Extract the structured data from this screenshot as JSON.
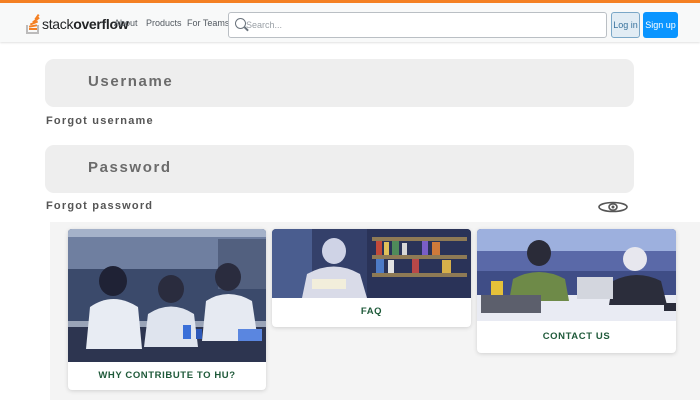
{
  "header": {
    "logo_plain": "stack",
    "logo_bold": "overflow",
    "nav": [
      "About",
      "Products",
      "For Teams"
    ],
    "search_placeholder": "Search...",
    "login_label": "Log in",
    "signup_label": "Sign up"
  },
  "form": {
    "username_placeholder": "Username",
    "forgot_username": "Forgot username",
    "password_placeholder": "Password",
    "forgot_password": "Forgot password"
  },
  "cards": [
    {
      "label": "WHY CONTRIBUTE TO HU?"
    },
    {
      "label": "FAQ"
    },
    {
      "label": "CONTACT US"
    }
  ],
  "colors": {
    "accent": "#f48024",
    "signup": "#0a95ff",
    "card_label": "#1f5a3a"
  }
}
